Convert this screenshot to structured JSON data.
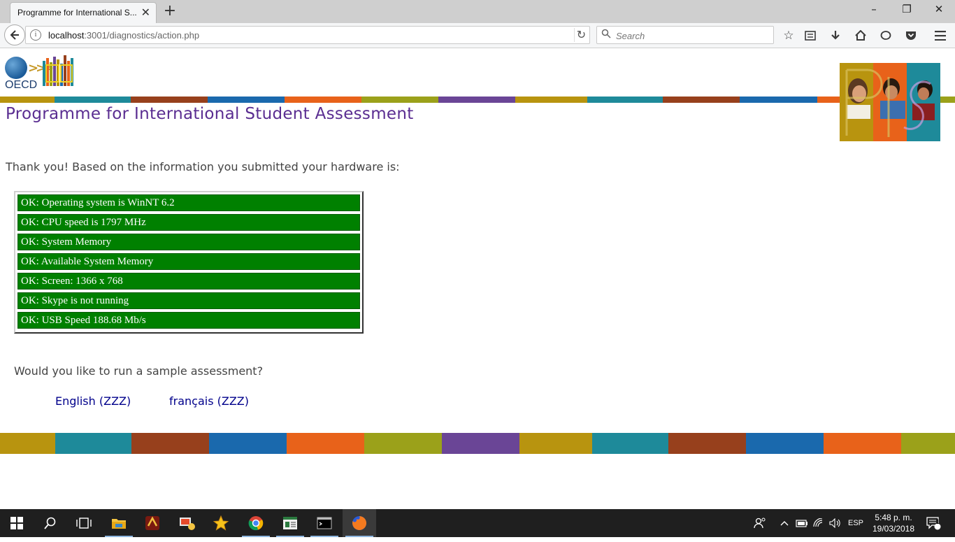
{
  "browser": {
    "tab_title": "Programme for International S...",
    "tab_close": "✕",
    "new_tab": "+",
    "url_host": "localhost",
    "url_rest": ":3001/diagnostics/action.php",
    "search_placeholder": "Search",
    "window": {
      "minimize": "–",
      "restore": "❐",
      "close": "✕"
    }
  },
  "header": {
    "logo_text": "OECD",
    "title": "Programme for International Student Assessment"
  },
  "main": {
    "intro": "Thank you! Based on the information you submitted your hardware is:",
    "checks": [
      "OK: Operating system is WinNT 6.2",
      "OK: CPU speed is 1797 MHz",
      "OK: System Memory",
      "OK: Available System Memory",
      "OK: Screen: 1366 x 768",
      "OK: Skype is not running",
      "OK: USB Speed 188.68 Mb/s"
    ],
    "question": "Would you like to run a sample assessment?",
    "links": [
      "English (ZZZ)",
      "français (ZZZ)"
    ]
  },
  "colors": {
    "band": [
      "#b8940f",
      "#1e8a9a",
      "#97401c",
      "#1a69ad",
      "#e8621a",
      "#9ba11a",
      "#6a4596",
      "#b8940f",
      "#1e8a9a",
      "#97401c",
      "#1a69ad",
      "#e8621a",
      "#9ba11a"
    ],
    "ok_green": "#008000",
    "title_purple": "#5a2d91"
  },
  "taskbar": {
    "lang": "ESP",
    "time": "5:48 p. m.",
    "date": "19/03/2018",
    "notifications": "1"
  }
}
